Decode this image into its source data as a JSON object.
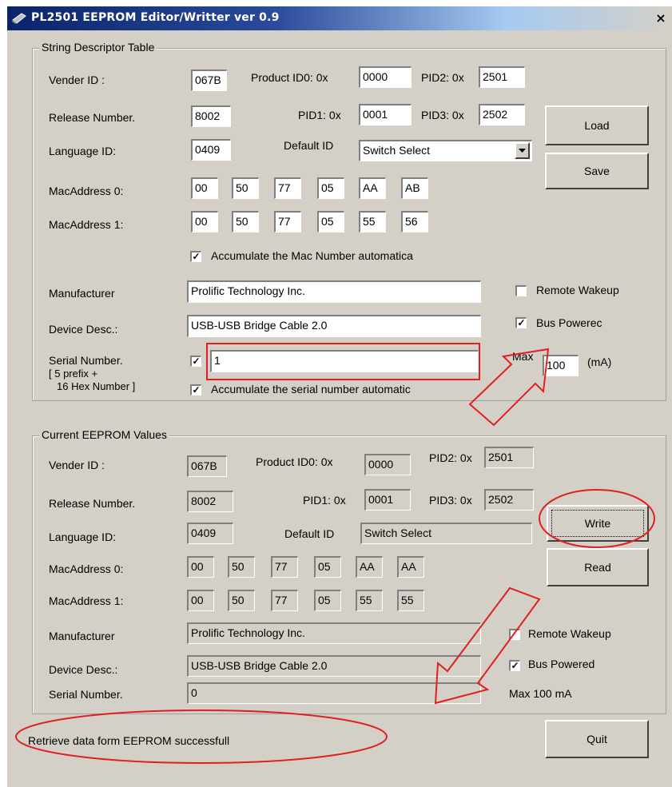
{
  "window": {
    "title": "PL2501 EEPROM Editor/Writter ver 0.9",
    "close_glyph": "×"
  },
  "desc_group": {
    "title": "String Descriptor Table",
    "vid_label": "Vender ID :",
    "vid": "067B",
    "pid0_label": "Product ID0: 0x",
    "pid0": "0000",
    "pid2_label": "PID2: 0x",
    "pid2": "2501",
    "release_label": "Release Number.",
    "release": "8002",
    "pid1_label": "PID1: 0x",
    "pid1": "0001",
    "pid3_label": "PID3: 0x",
    "pid3": "2502",
    "lang_label": "Language ID:",
    "lang": "0409",
    "default_label": "Default ID",
    "default_value": "Switch Select",
    "mac0_label": "MacAddress 0:",
    "mac0": [
      "00",
      "50",
      "77",
      "05",
      "AA",
      "AB"
    ],
    "mac1_label": "MacAddress 1:",
    "mac1": [
      "00",
      "50",
      "77",
      "05",
      "55",
      "56"
    ],
    "accumulate_mac": "Accumulate the Mac Number automatica",
    "manufacturer_label": "Manufacturer",
    "manufacturer": "Prolific Technology Inc.",
    "device_label": "Device Desc.:",
    "device": "USB-USB Bridge Cable 2.0",
    "serial_label": "Serial Number.",
    "serial_note1": "[ 5 prefix +",
    "serial_note2": "16 Hex Number ]",
    "serial": "1",
    "accumulate_serial": "Accumulate the serial number automatic",
    "remote_wakeup": "Remote Wakeup",
    "bus_powered": "Bus Powerec",
    "max_label": "Max",
    "max_value": "100",
    "max_unit": "(mA)"
  },
  "buttons": {
    "load": "Load",
    "save": "Save",
    "write": "Write",
    "read": "Read",
    "quit": "Quit"
  },
  "current_group": {
    "title": "Current EEPROM Values",
    "vid_label": "Vender ID :",
    "vid": "067B",
    "pid0_label": "Product ID0: 0x",
    "pid0": "0000",
    "pid2_label": "PID2: 0x",
    "pid2": "2501",
    "release_label": "Release Number.",
    "release": "8002",
    "pid1_label": "PID1: 0x",
    "pid1": "0001",
    "pid3_label": "PID3: 0x",
    "pid3": "2502",
    "lang_label": "Language ID:",
    "lang": "0409",
    "default_label": "Default ID",
    "default_value": "Switch Select",
    "mac0_label": "MacAddress 0:",
    "mac0": [
      "00",
      "50",
      "77",
      "05",
      "AA",
      "AA"
    ],
    "mac1_label": "MacAddress 1:",
    "mac1": [
      "00",
      "50",
      "77",
      "05",
      "55",
      "55"
    ],
    "manufacturer_label": "Manufacturer",
    "manufacturer": "Prolific Technology Inc.",
    "device_label": "Device Desc.:",
    "device": "USB-USB Bridge Cable 2.0",
    "serial_label": "Serial Number.",
    "serial": "0",
    "remote_wakeup": "Remote Wakeup",
    "bus_powered": "Bus Powered",
    "max_text": "Max 100 mA"
  },
  "status_text": "Retrieve data form EEPROM successfull",
  "checks": {
    "accumulate_mac": true,
    "serial_enable": true,
    "accumulate_serial": true,
    "remote_wakeup": false,
    "bus_powered": true,
    "cur_remote_wakeup": false,
    "cur_bus_powered": true
  },
  "annotation_color": "#e02020"
}
